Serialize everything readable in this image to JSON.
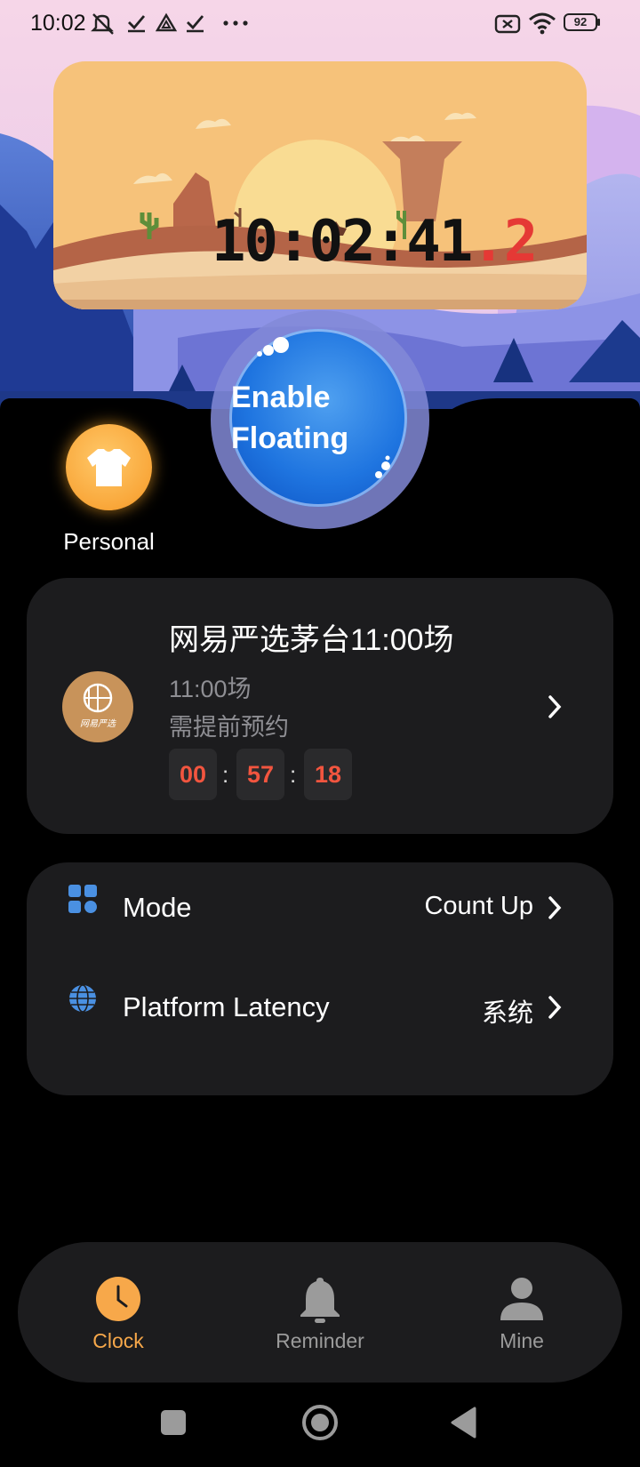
{
  "status_bar": {
    "time": "10:02",
    "battery": "92"
  },
  "clock": {
    "time": "10:02:41",
    "decimal": ".2"
  },
  "floating": {
    "line1": "Enable",
    "line2": "Floating"
  },
  "personal": {
    "label": "Personal"
  },
  "event": {
    "title": "网易严选茅台11:00场",
    "subtitle": "11:00场",
    "note": "需提前预约",
    "avatar_text": "网易严选",
    "countdown": {
      "hours": "00",
      "minutes": "57",
      "seconds": "18",
      "separator": ":"
    }
  },
  "settings": {
    "mode_label": "Mode",
    "mode_value": "Count Up",
    "latency_label": "Platform Latency",
    "latency_value": "系统"
  },
  "nav": {
    "clock_label": "Clock",
    "reminder_label": "Reminder",
    "mine_label": "Mine",
    "active": "clock"
  },
  "colors": {
    "accent_orange": "#f7a84a",
    "countdown_red": "#f2553f",
    "card_bg": "#1c1c1e",
    "icon_blue": "#4a90e2"
  },
  "icons": {
    "mode": "grid-icon",
    "latency": "globe-icon",
    "personal": "tshirt-icon"
  }
}
